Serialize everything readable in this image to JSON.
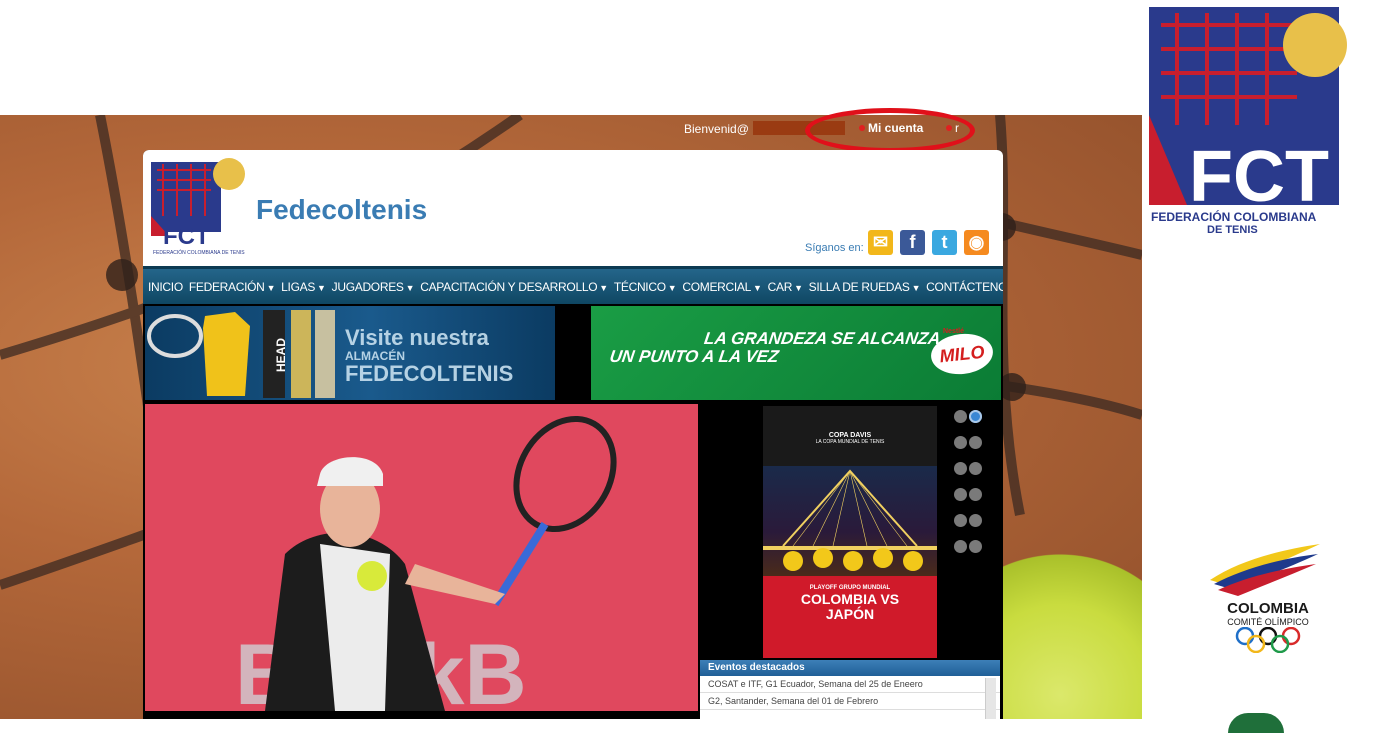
{
  "topbar": {
    "greeting": "Bienvenid@",
    "my_account": "Mi cuenta",
    "logout": "r"
  },
  "header": {
    "logo_text": "FCT",
    "logo_subtext": "FEDERACIÓN COLOMBIANA DE TENIS",
    "site_name": "Fedecoltenis",
    "follow_label": "Síganos en:",
    "social_icons": [
      "mail-icon",
      "facebook-icon",
      "twitter-icon",
      "rss-icon"
    ]
  },
  "nav": {
    "items": [
      {
        "label": "INICIO",
        "dropdown": false
      },
      {
        "label": "FEDERACIÓN",
        "dropdown": true
      },
      {
        "label": "LIGAS",
        "dropdown": true
      },
      {
        "label": "JUGADORES",
        "dropdown": true
      },
      {
        "label": "CAPACITACIÓN Y DESARROLLO",
        "dropdown": true
      },
      {
        "label": "TÉCNICO",
        "dropdown": true
      },
      {
        "label": "COMERCIAL",
        "dropdown": true
      },
      {
        "label": "CAR",
        "dropdown": true
      },
      {
        "label": "SILLA DE RUEDAS",
        "dropdown": true
      },
      {
        "label": "CONTÁCTENOS",
        "dropdown": false
      }
    ]
  },
  "banners": {
    "store_text_1": "Visite nuestra",
    "store_text_2": "ALMACÉN",
    "store_text_3": "FEDECOLTENIS",
    "brand": "HEAD",
    "milo_slogan_1": "LA GRANDEZA SE ALCANZA",
    "milo_slogan_2": "UN PUNTO A LA VEZ",
    "milo_brand": "MILO",
    "milo_maker": "Nestlé"
  },
  "poster": {
    "event": "COPA DAVIS",
    "subtitle": "LA COPA MUNDIAL DE TENIS",
    "stage": "PLAYOFF GRUPO MUNDIAL",
    "match_1": "COLOMBIA VS",
    "match_2": "JAPÓN"
  },
  "photo": {
    "sponsor_text": "BlackB"
  },
  "slider": {
    "count": 12,
    "active": 1
  },
  "events": {
    "title": "Eventos destacados",
    "rows": [
      "COSAT e ITF, G1 Ecuador, Semana del 25 de Eneero",
      "G2, Santander, Semana del 01 de Febrero"
    ]
  },
  "side_logo": {
    "name": "FEDERACIÓN COLOMBIANA",
    "sub": "DE TENIS",
    "mark": "FCT"
  },
  "olympic": {
    "name": "COLOMBIA",
    "sub": "COMITÉ OLÍMPICO"
  },
  "colors": {
    "accent": "#3a7cb3",
    "nav": "#1a5878",
    "highlight_circle": "#e0101a"
  }
}
